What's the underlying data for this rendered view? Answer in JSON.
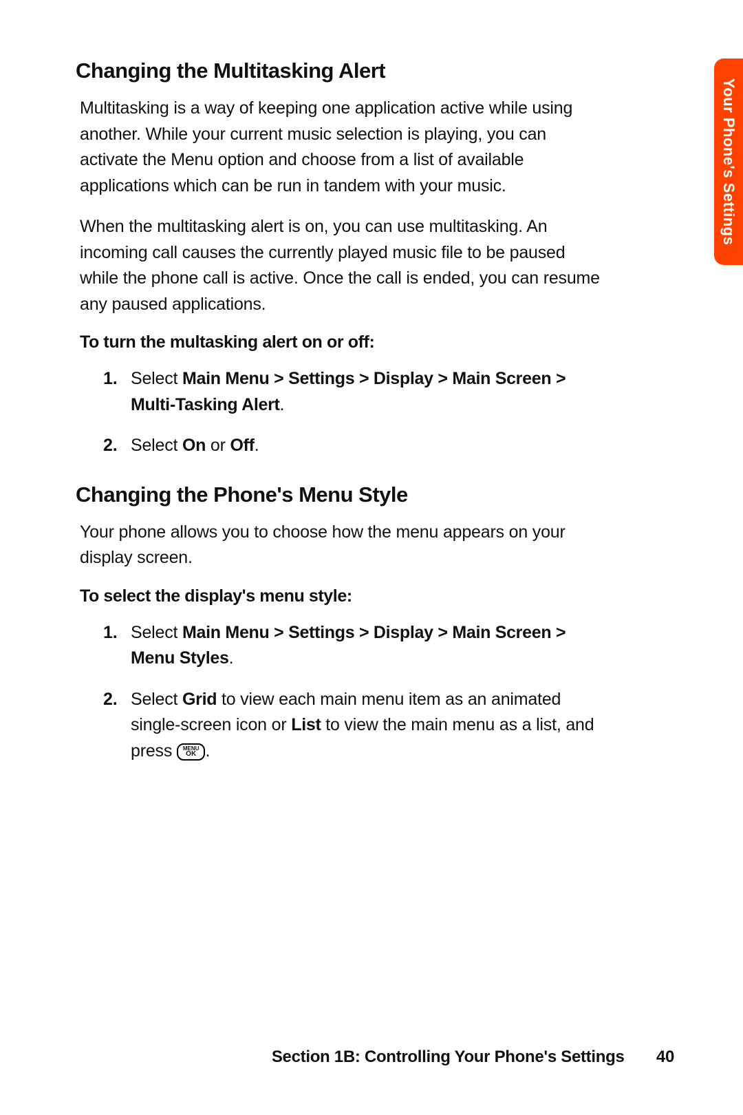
{
  "sideTab": {
    "label": "Your Phone's Settings"
  },
  "section1": {
    "heading": "Changing the Multitasking Alert",
    "para1": "Multitasking is a way of keeping one application active while using another. While your current music selection is playing, you can activate the Menu option and choose from a list of available applications which can be run in tandem with your music.",
    "para2": " When the multitasking alert is on, you can use multitasking. An incoming call causes the currently played music file to be paused while the phone call is active. Once the call is ended, you can resume any paused applications.",
    "leadin": "To turn the multasking alert on or off:",
    "step1": {
      "num": "1.",
      "pre": "Select ",
      "bold": "Main Menu > Settings > Display > Main Screen > Multi-Tasking Alert",
      "post": "."
    },
    "step2": {
      "num": "2.",
      "pre": "Select ",
      "bold1": "On",
      "mid": " or ",
      "bold2": "Off",
      "post": "."
    }
  },
  "section2": {
    "heading": "Changing the Phone's Menu Style",
    "para1": "Your phone allows you to choose how the menu appears on your display screen.",
    "leadin": "To select the display's menu style:",
    "step1": {
      "num": "1.",
      "pre": "Select ",
      "bold": "Main Menu > Settings > Display > Main Screen > Menu Styles",
      "post": "."
    },
    "step2": {
      "num": "2.",
      "pre": "Select ",
      "bold1": "Grid",
      "mid1": " to view each main menu item as an animated single-screen icon or ",
      "bold2": "List",
      "mid2": " to view the main menu as a list, and press ",
      "post": "."
    }
  },
  "key": {
    "top": "MENU",
    "bottom": "OK"
  },
  "footer": {
    "section": "Section 1B: Controlling Your Phone's Settings",
    "page": "40"
  }
}
